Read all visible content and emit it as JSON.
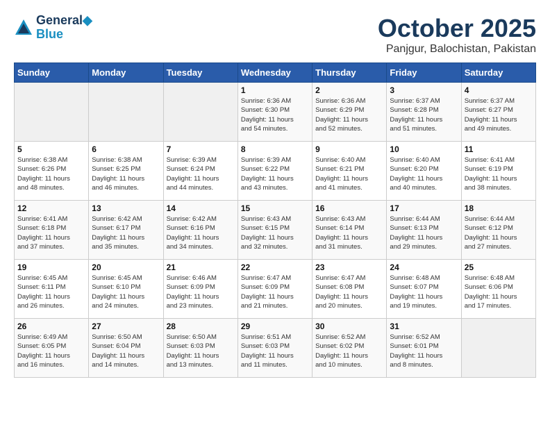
{
  "header": {
    "logo_line1": "General",
    "logo_line2": "Blue",
    "month": "October 2025",
    "location": "Panjgur, Balochistan, Pakistan"
  },
  "weekdays": [
    "Sunday",
    "Monday",
    "Tuesday",
    "Wednesday",
    "Thursday",
    "Friday",
    "Saturday"
  ],
  "weeks": [
    [
      {
        "day": "",
        "info": ""
      },
      {
        "day": "",
        "info": ""
      },
      {
        "day": "",
        "info": ""
      },
      {
        "day": "1",
        "info": "Sunrise: 6:36 AM\nSunset: 6:30 PM\nDaylight: 11 hours\nand 54 minutes."
      },
      {
        "day": "2",
        "info": "Sunrise: 6:36 AM\nSunset: 6:29 PM\nDaylight: 11 hours\nand 52 minutes."
      },
      {
        "day": "3",
        "info": "Sunrise: 6:37 AM\nSunset: 6:28 PM\nDaylight: 11 hours\nand 51 minutes."
      },
      {
        "day": "4",
        "info": "Sunrise: 6:37 AM\nSunset: 6:27 PM\nDaylight: 11 hours\nand 49 minutes."
      }
    ],
    [
      {
        "day": "5",
        "info": "Sunrise: 6:38 AM\nSunset: 6:26 PM\nDaylight: 11 hours\nand 48 minutes."
      },
      {
        "day": "6",
        "info": "Sunrise: 6:38 AM\nSunset: 6:25 PM\nDaylight: 11 hours\nand 46 minutes."
      },
      {
        "day": "7",
        "info": "Sunrise: 6:39 AM\nSunset: 6:24 PM\nDaylight: 11 hours\nand 44 minutes."
      },
      {
        "day": "8",
        "info": "Sunrise: 6:39 AM\nSunset: 6:22 PM\nDaylight: 11 hours\nand 43 minutes."
      },
      {
        "day": "9",
        "info": "Sunrise: 6:40 AM\nSunset: 6:21 PM\nDaylight: 11 hours\nand 41 minutes."
      },
      {
        "day": "10",
        "info": "Sunrise: 6:40 AM\nSunset: 6:20 PM\nDaylight: 11 hours\nand 40 minutes."
      },
      {
        "day": "11",
        "info": "Sunrise: 6:41 AM\nSunset: 6:19 PM\nDaylight: 11 hours\nand 38 minutes."
      }
    ],
    [
      {
        "day": "12",
        "info": "Sunrise: 6:41 AM\nSunset: 6:18 PM\nDaylight: 11 hours\nand 37 minutes."
      },
      {
        "day": "13",
        "info": "Sunrise: 6:42 AM\nSunset: 6:17 PM\nDaylight: 11 hours\nand 35 minutes."
      },
      {
        "day": "14",
        "info": "Sunrise: 6:42 AM\nSunset: 6:16 PM\nDaylight: 11 hours\nand 34 minutes."
      },
      {
        "day": "15",
        "info": "Sunrise: 6:43 AM\nSunset: 6:15 PM\nDaylight: 11 hours\nand 32 minutes."
      },
      {
        "day": "16",
        "info": "Sunrise: 6:43 AM\nSunset: 6:14 PM\nDaylight: 11 hours\nand 31 minutes."
      },
      {
        "day": "17",
        "info": "Sunrise: 6:44 AM\nSunset: 6:13 PM\nDaylight: 11 hours\nand 29 minutes."
      },
      {
        "day": "18",
        "info": "Sunrise: 6:44 AM\nSunset: 6:12 PM\nDaylight: 11 hours\nand 27 minutes."
      }
    ],
    [
      {
        "day": "19",
        "info": "Sunrise: 6:45 AM\nSunset: 6:11 PM\nDaylight: 11 hours\nand 26 minutes."
      },
      {
        "day": "20",
        "info": "Sunrise: 6:45 AM\nSunset: 6:10 PM\nDaylight: 11 hours\nand 24 minutes."
      },
      {
        "day": "21",
        "info": "Sunrise: 6:46 AM\nSunset: 6:09 PM\nDaylight: 11 hours\nand 23 minutes."
      },
      {
        "day": "22",
        "info": "Sunrise: 6:47 AM\nSunset: 6:09 PM\nDaylight: 11 hours\nand 21 minutes."
      },
      {
        "day": "23",
        "info": "Sunrise: 6:47 AM\nSunset: 6:08 PM\nDaylight: 11 hours\nand 20 minutes."
      },
      {
        "day": "24",
        "info": "Sunrise: 6:48 AM\nSunset: 6:07 PM\nDaylight: 11 hours\nand 19 minutes."
      },
      {
        "day": "25",
        "info": "Sunrise: 6:48 AM\nSunset: 6:06 PM\nDaylight: 11 hours\nand 17 minutes."
      }
    ],
    [
      {
        "day": "26",
        "info": "Sunrise: 6:49 AM\nSunset: 6:05 PM\nDaylight: 11 hours\nand 16 minutes."
      },
      {
        "day": "27",
        "info": "Sunrise: 6:50 AM\nSunset: 6:04 PM\nDaylight: 11 hours\nand 14 minutes."
      },
      {
        "day": "28",
        "info": "Sunrise: 6:50 AM\nSunset: 6:03 PM\nDaylight: 11 hours\nand 13 minutes."
      },
      {
        "day": "29",
        "info": "Sunrise: 6:51 AM\nSunset: 6:03 PM\nDaylight: 11 hours\nand 11 minutes."
      },
      {
        "day": "30",
        "info": "Sunrise: 6:52 AM\nSunset: 6:02 PM\nDaylight: 11 hours\nand 10 minutes."
      },
      {
        "day": "31",
        "info": "Sunrise: 6:52 AM\nSunset: 6:01 PM\nDaylight: 11 hours\nand 8 minutes."
      },
      {
        "day": "",
        "info": ""
      }
    ]
  ]
}
